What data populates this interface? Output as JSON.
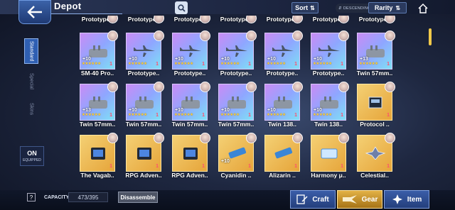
{
  "header": {
    "title": "Depot",
    "sort_label": "Sort",
    "order_label": "DESCENDING",
    "rarity_label": "Rarity"
  },
  "side_tabs": [
    "Standard",
    "Special",
    "Skins"
  ],
  "equipped": {
    "state": "ON",
    "label": "EQUIPPED"
  },
  "colors": {
    "accent": "#f0c84a",
    "tile_rare": "#b98cf5",
    "tile_gold": "#e8b04a",
    "count_red": "#ff4f6e"
  },
  "grid": {
    "row0": [
      "Prototype..",
      "Prototype..",
      "Prototype..",
      "Prototype..",
      "Prototype..",
      "Prototype..",
      "Prototype.."
    ],
    "row1": [
      {
        "name": "SM-40 Pro..",
        "level": "+10",
        "stars": "★★★★★★",
        "count": "1",
        "art": "turret-icon",
        "tier": "rare"
      },
      {
        "name": "Prototype..",
        "level": "+10",
        "stars": "★★★★★★",
        "count": "1",
        "art": "plane-icon",
        "tier": "rare"
      },
      {
        "name": "Prototype..",
        "level": "+10",
        "stars": "★★★★★★",
        "count": "1",
        "art": "plane-icon",
        "tier": "rare"
      },
      {
        "name": "Prototype..",
        "level": "+10",
        "stars": "★★★★★★",
        "count": "1",
        "art": "plane-icon",
        "tier": "rare"
      },
      {
        "name": "Prototype..",
        "level": "+10",
        "stars": "★★★★★★",
        "count": "1",
        "art": "plane-icon",
        "tier": "rare"
      },
      {
        "name": "Prototype..",
        "level": "+10",
        "stars": "★★★★★★",
        "count": "1",
        "art": "plane-icon",
        "tier": "rare"
      },
      {
        "name": "Twin 57mm..",
        "level": "+13",
        "stars": "★★★★★★",
        "count": "1",
        "art": "turret-icon",
        "tier": "rare"
      }
    ],
    "row2": [
      {
        "name": "Twin 57mm..",
        "level": "+13",
        "stars": "★★★★★★",
        "count": "1",
        "art": "turret-icon",
        "tier": "rare"
      },
      {
        "name": "Twin 57mm..",
        "level": "+10",
        "stars": "★★★★★★",
        "count": "1",
        "art": "turret-icon",
        "tier": "rare"
      },
      {
        "name": "Twin 57mm..",
        "level": "+10",
        "stars": "★★★★★★",
        "count": "1",
        "art": "turret-icon",
        "tier": "rare"
      },
      {
        "name": "Twin 57mm..",
        "level": "+10",
        "stars": "★★★★★★",
        "count": "1",
        "art": "turret-icon",
        "tier": "rare"
      },
      {
        "name": "Twin 138..",
        "level": "+10",
        "stars": "★★★★★★",
        "count": "1",
        "art": "turret-icon",
        "tier": "rare"
      },
      {
        "name": "Twin 138..",
        "level": "+10",
        "stars": "★★★★★★",
        "count": "1",
        "art": "turret-icon",
        "tier": "rare"
      },
      {
        "name": "Protocol ..",
        "level": "",
        "stars": "",
        "count": "1",
        "art": "chip-icon",
        "tier": "gold"
      }
    ],
    "row3": [
      {
        "name": "The Vagab..",
        "level": "",
        "stars": "",
        "count": "1",
        "art": "tablet-icon",
        "tier": "gold"
      },
      {
        "name": "RPG Adven..",
        "level": "",
        "stars": "",
        "count": "1",
        "art": "tablet-icon",
        "tier": "gold"
      },
      {
        "name": "RPG Adven..",
        "level": "",
        "stars": "",
        "count": "1",
        "art": "tablet-icon",
        "tier": "gold"
      },
      {
        "name": "Cyanidin ..",
        "level": "+10",
        "stars": "",
        "count": "1",
        "art": "stick-icon",
        "tier": "gold"
      },
      {
        "name": "Alizarin ..",
        "level": "",
        "stars": "",
        "count": "1",
        "art": "stick-icon",
        "tier": "gold"
      },
      {
        "name": "Harmony μ..",
        "level": "",
        "stars": "",
        "count": "1",
        "art": "ticket-icon",
        "tier": "gold"
      },
      {
        "name": "Celestial..",
        "level": "",
        "stars": "",
        "count": "1",
        "art": "emblem-icon",
        "tier": "gold"
      }
    ]
  },
  "footer": {
    "help": "?",
    "capacity_label": "CAPACITY",
    "capacity_value": "473/395",
    "disassemble_label": "Disassemble",
    "tabs": [
      {
        "label": "Craft",
        "icon": "craft-icon"
      },
      {
        "label": "Gear",
        "icon": "gear-wing-icon"
      },
      {
        "label": "Item",
        "icon": "star-item-icon"
      }
    ]
  }
}
